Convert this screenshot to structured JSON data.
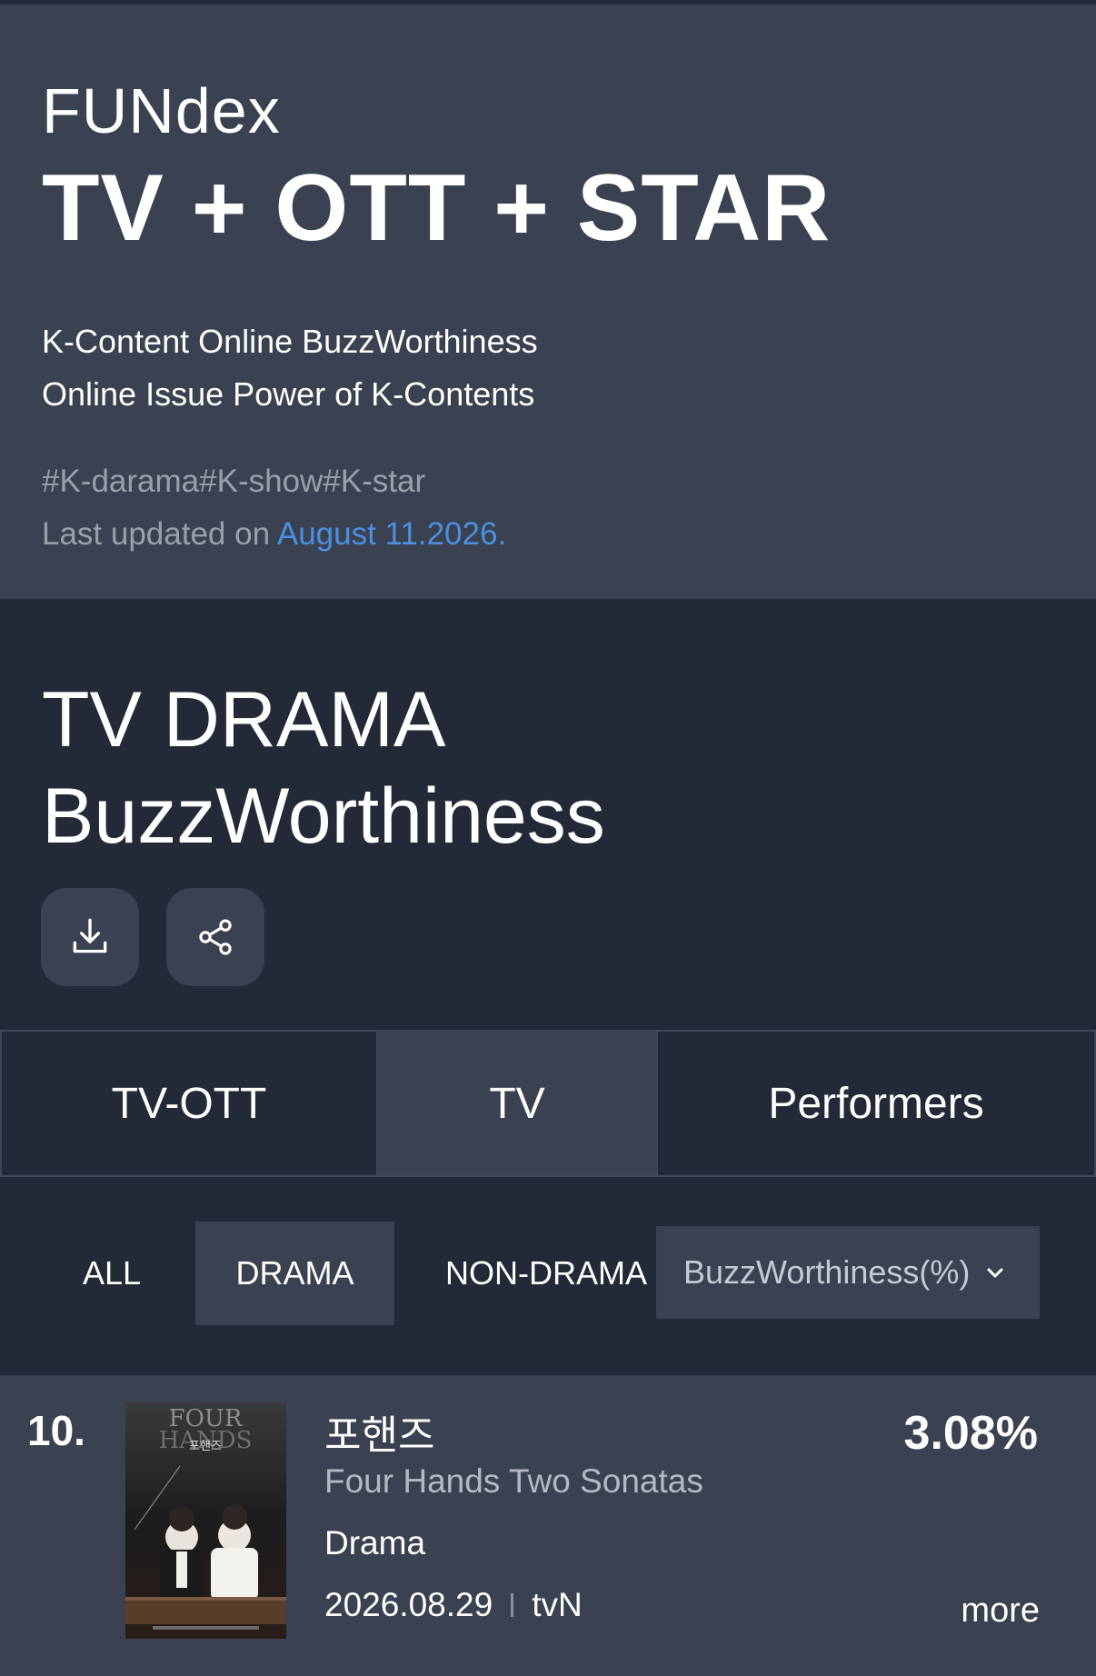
{
  "hero": {
    "brand": "FUNdex",
    "headline": "TV + OTT + STAR",
    "tagline_1": "K-Content Online BuzzWorthiness",
    "tagline_2": "Online Issue Power of K-Contents",
    "hashtags": "#K-darama#K-show#K-star",
    "updated_prefix": "Last updated on ",
    "updated_date": "August 11.2026."
  },
  "section": {
    "title_line1": "TV DRAMA",
    "title_line2": "BuzzWorthiness",
    "download_icon": "download-icon",
    "share_icon": "share-icon"
  },
  "tabs": [
    {
      "label": "TV-OTT",
      "active": false
    },
    {
      "label": "TV",
      "active": true
    },
    {
      "label": "Performers",
      "active": false
    }
  ],
  "filters": {
    "chips": [
      {
        "label": "ALL",
        "active": false
      },
      {
        "label": "DRAMA",
        "active": true
      },
      {
        "label": "NON-DRAMA",
        "active": false
      }
    ],
    "metric_select": "BuzzWorthiness(%)"
  },
  "ranking": [
    {
      "rank": "10.",
      "title_korean": "포핸즈",
      "title_english": "Four Hands Two Sonatas",
      "genre": "Drama",
      "air_date": "2026.08.29",
      "channel": "tvN",
      "score": "3.08%",
      "more_label": "more",
      "poster_text_top": "FOUR",
      "poster_text_mid": "HANDS",
      "poster_text_kor": "포핸즈"
    }
  ],
  "colors": {
    "background_dark": "#232937",
    "panel": "#3a4150",
    "accent_blue": "#4a8fe0",
    "muted_text": "#9aa0aa"
  }
}
